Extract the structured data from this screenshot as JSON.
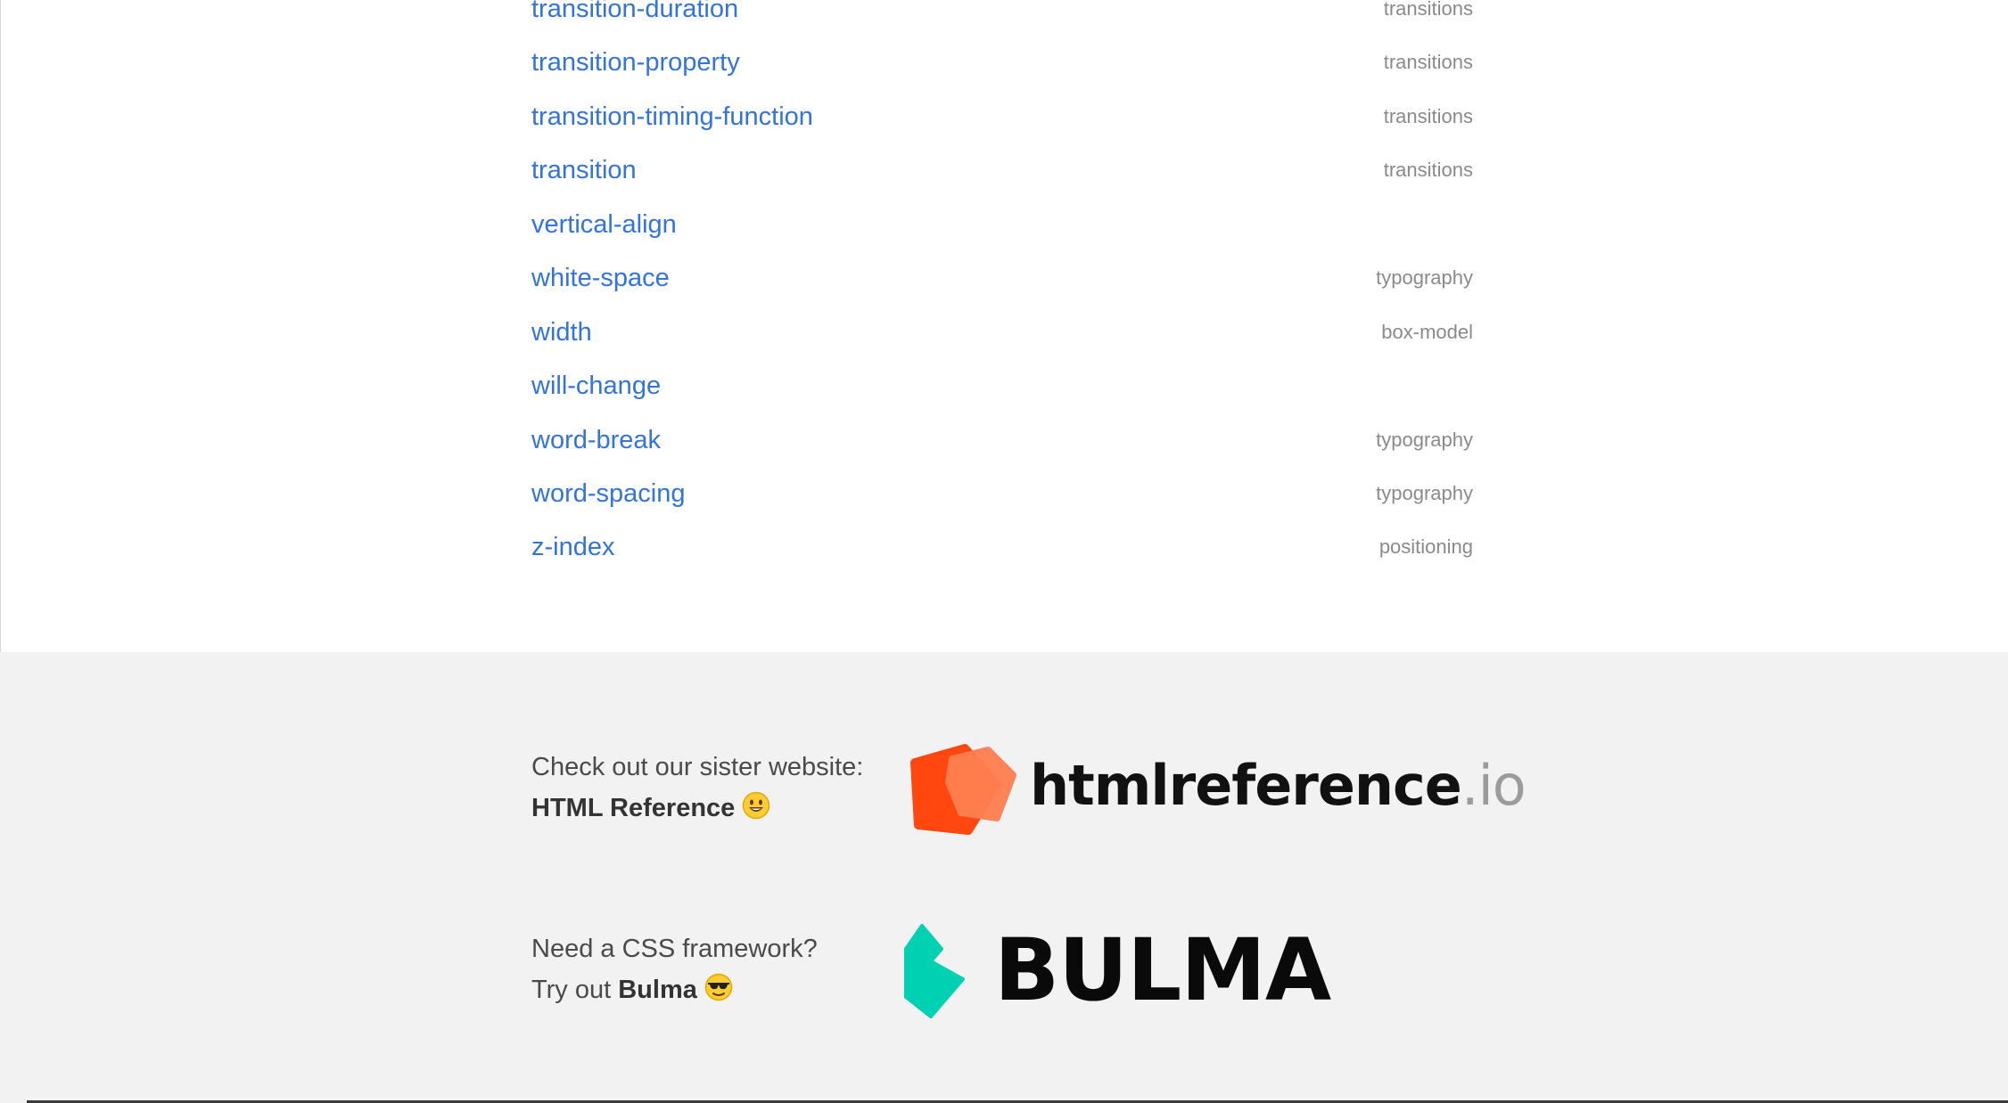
{
  "properties": [
    {
      "name": "transition-duration",
      "category": "transitions"
    },
    {
      "name": "transition-property",
      "category": "transitions"
    },
    {
      "name": "transition-timing-function",
      "category": "transitions"
    },
    {
      "name": "transition",
      "category": "transitions"
    },
    {
      "name": "vertical-align",
      "category": ""
    },
    {
      "name": "white-space",
      "category": "typography"
    },
    {
      "name": "width",
      "category": "box-model"
    },
    {
      "name": "will-change",
      "category": ""
    },
    {
      "name": "word-break",
      "category": "typography"
    },
    {
      "name": "word-spacing",
      "category": "typography"
    },
    {
      "name": "z-index",
      "category": "positioning"
    }
  ],
  "footer": {
    "sister": {
      "line1": "Check out our sister website:",
      "link_label": "HTML Reference",
      "emoji": "smiley-emoji",
      "logo_word": "htmlreference",
      "logo_tld": ".io",
      "logo_colors": {
        "front": "#ff470f",
        "back": "#ff7f50"
      }
    },
    "bulma": {
      "line1": "Need a CSS framework?",
      "line2_prefix": "Try out",
      "link_label": "Bulma",
      "emoji": "sunglasses-emoji",
      "logo_word": "BULMA",
      "logo_color": "#00d1b2"
    }
  }
}
